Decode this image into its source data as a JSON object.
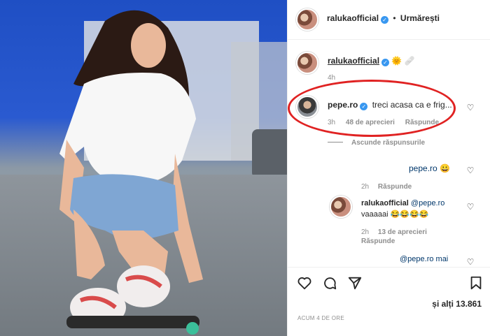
{
  "post": {
    "author": "ralukaofficial",
    "follow_label": "Urmărești",
    "dot": "•"
  },
  "caption": {
    "author": "ralukaofficial",
    "emoji": "🌞 🩹",
    "time": "4h"
  },
  "comments": [
    {
      "author": "pepe.ro",
      "text": "treci acasa ca e frig...",
      "time": "3h",
      "likes": "48 de aprecieri",
      "reply": "Răspunde",
      "hide_replies": "Ascunde răspunsurile"
    }
  ],
  "replies": [
    {
      "text": "pepe.ro 😀",
      "time": "2h",
      "reply": "Răspunde"
    },
    {
      "author": "ralukaofficial",
      "mention": "@pepe.ro",
      "text": "vaaaaai 😂😂😂😂",
      "time": "2h",
      "likes": "13 de aprecieri",
      "reply": "Răspunde"
    },
    {
      "text": "@pepe.ro mai"
    }
  ],
  "footer": {
    "likes_suffix": "și alți 13.861",
    "timestamp": "ACUM 4 DE ORE"
  },
  "colors": {
    "verified": "#3897f0",
    "highlight": "#e02222"
  },
  "icons": [
    "heart-icon",
    "comment-icon",
    "share-icon",
    "bookmark-icon"
  ]
}
